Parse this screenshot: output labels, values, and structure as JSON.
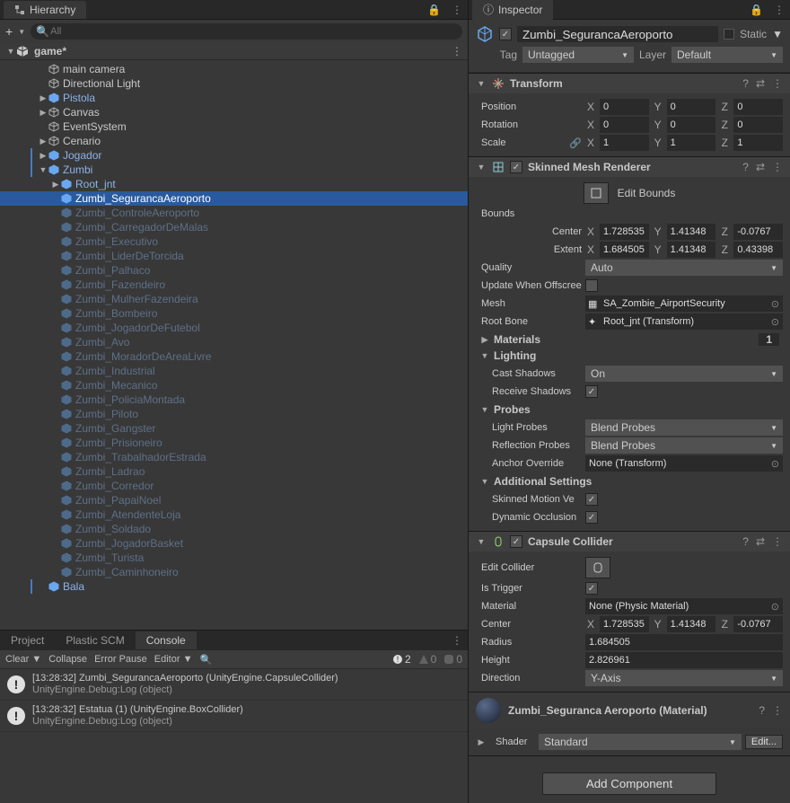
{
  "hierarchy": {
    "tab": "Hierarchy",
    "search_placeholder": "All",
    "scene": "game*",
    "items": [
      {
        "label": "main camera",
        "depth": 1,
        "prefab": false,
        "ghost": false,
        "arrow": ""
      },
      {
        "label": "Directional Light",
        "depth": 1,
        "prefab": false,
        "ghost": false,
        "arrow": ""
      },
      {
        "label": "Pistola",
        "depth": 1,
        "prefab": true,
        "ghost": false,
        "arrow": "▶"
      },
      {
        "label": "Canvas",
        "depth": 1,
        "prefab": false,
        "ghost": false,
        "arrow": "▶"
      },
      {
        "label": "EventSystem",
        "depth": 1,
        "prefab": false,
        "ghost": false,
        "arrow": ""
      },
      {
        "label": "Cenario",
        "depth": 1,
        "prefab": false,
        "ghost": false,
        "arrow": "▶"
      },
      {
        "label": "Jogador",
        "depth": 1,
        "prefab": true,
        "ghost": false,
        "arrow": "▶",
        "bar": true
      },
      {
        "label": "Zumbi",
        "depth": 1,
        "prefab": true,
        "ghost": false,
        "arrow": "▼",
        "bar": true
      },
      {
        "label": "Root_jnt",
        "depth": 2,
        "prefab": true,
        "ghost": false,
        "arrow": "▶"
      },
      {
        "label": "Zumbi_SegurancaAeroporto",
        "depth": 2,
        "prefab": true,
        "ghost": false,
        "arrow": "",
        "selected": true
      },
      {
        "label": "Zumbi_ControleAeroporto",
        "depth": 2,
        "prefab": true,
        "ghost": true,
        "arrow": ""
      },
      {
        "label": "Zumbi_CarregadorDeMalas",
        "depth": 2,
        "prefab": true,
        "ghost": true,
        "arrow": ""
      },
      {
        "label": "Zumbi_Executivo",
        "depth": 2,
        "prefab": true,
        "ghost": true,
        "arrow": ""
      },
      {
        "label": "Zumbi_LiderDeTorcida",
        "depth": 2,
        "prefab": true,
        "ghost": true,
        "arrow": ""
      },
      {
        "label": "Zumbi_Palhaco",
        "depth": 2,
        "prefab": true,
        "ghost": true,
        "arrow": ""
      },
      {
        "label": "Zumbi_Fazendeiro",
        "depth": 2,
        "prefab": true,
        "ghost": true,
        "arrow": ""
      },
      {
        "label": "Zumbi_MulherFazendeira",
        "depth": 2,
        "prefab": true,
        "ghost": true,
        "arrow": ""
      },
      {
        "label": "Zumbi_Bombeiro",
        "depth": 2,
        "prefab": true,
        "ghost": true,
        "arrow": ""
      },
      {
        "label": "Zumbi_JogadorDeFutebol",
        "depth": 2,
        "prefab": true,
        "ghost": true,
        "arrow": ""
      },
      {
        "label": "Zumbi_Avo",
        "depth": 2,
        "prefab": true,
        "ghost": true,
        "arrow": ""
      },
      {
        "label": "Zumbi_MoradorDeAreaLivre",
        "depth": 2,
        "prefab": true,
        "ghost": true,
        "arrow": ""
      },
      {
        "label": "Zumbi_Industrial",
        "depth": 2,
        "prefab": true,
        "ghost": true,
        "arrow": ""
      },
      {
        "label": "Zumbi_Mecanico",
        "depth": 2,
        "prefab": true,
        "ghost": true,
        "arrow": ""
      },
      {
        "label": "Zumbi_PoliciaMontada",
        "depth": 2,
        "prefab": true,
        "ghost": true,
        "arrow": ""
      },
      {
        "label": "Zumbi_Piloto",
        "depth": 2,
        "prefab": true,
        "ghost": true,
        "arrow": ""
      },
      {
        "label": "Zumbi_Gangster",
        "depth": 2,
        "prefab": true,
        "ghost": true,
        "arrow": ""
      },
      {
        "label": "Zumbi_Prisioneiro",
        "depth": 2,
        "prefab": true,
        "ghost": true,
        "arrow": ""
      },
      {
        "label": "Zumbi_TrabalhadorEstrada",
        "depth": 2,
        "prefab": true,
        "ghost": true,
        "arrow": ""
      },
      {
        "label": "Zumbi_Ladrao",
        "depth": 2,
        "prefab": true,
        "ghost": true,
        "arrow": ""
      },
      {
        "label": "Zumbi_Corredor",
        "depth": 2,
        "prefab": true,
        "ghost": true,
        "arrow": ""
      },
      {
        "label": "Zumbi_PapaiNoel",
        "depth": 2,
        "prefab": true,
        "ghost": true,
        "arrow": ""
      },
      {
        "label": "Zumbi_AtendenteLoja",
        "depth": 2,
        "prefab": true,
        "ghost": true,
        "arrow": ""
      },
      {
        "label": "Zumbi_Soldado",
        "depth": 2,
        "prefab": true,
        "ghost": true,
        "arrow": ""
      },
      {
        "label": "Zumbi_JogadorBasket",
        "depth": 2,
        "prefab": true,
        "ghost": true,
        "arrow": ""
      },
      {
        "label": "Zumbi_Turista",
        "depth": 2,
        "prefab": true,
        "ghost": true,
        "arrow": ""
      },
      {
        "label": "Zumbi_Caminhoneiro",
        "depth": 2,
        "prefab": true,
        "ghost": true,
        "arrow": ""
      },
      {
        "label": "Bala",
        "depth": 1,
        "prefab": true,
        "ghost": false,
        "arrow": "",
        "bar": true
      }
    ]
  },
  "bottom": {
    "tabs": [
      "Project",
      "Plastic SCM",
      "Console"
    ],
    "active_tab": 2,
    "toolbar": {
      "clear": "Clear",
      "collapse": "Collapse",
      "error_pause": "Error Pause",
      "editor": "Editor"
    },
    "counts": {
      "info": "2",
      "warn": "0",
      "error": "0"
    },
    "logs": [
      {
        "time": "[13:28:32]",
        "msg": "Zumbi_SegurancaAeroporto (UnityEngine.CapsuleCollider)",
        "sub": "UnityEngine.Debug:Log (object)"
      },
      {
        "time": "[13:28:32]",
        "msg": "Estatua (1) (UnityEngine.BoxCollider)",
        "sub": "UnityEngine.Debug:Log (object)"
      }
    ]
  },
  "inspector": {
    "tab": "Inspector",
    "name": "Zumbi_SegurancaAeroporto",
    "static": "Static",
    "tag_label": "Tag",
    "tag": "Untagged",
    "layer_label": "Layer",
    "layer": "Default",
    "transform": {
      "title": "Transform",
      "position": {
        "label": "Position",
        "x": "0",
        "y": "0",
        "z": "0"
      },
      "rotation": {
        "label": "Rotation",
        "x": "0",
        "y": "0",
        "z": "0"
      },
      "scale": {
        "label": "Scale",
        "x": "1",
        "y": "1",
        "z": "1"
      }
    },
    "smr": {
      "title": "Skinned Mesh Renderer",
      "edit_bounds": "Edit Bounds",
      "bounds": "Bounds",
      "center_label": "Center",
      "center": {
        "x": "1.728535",
        "y": "1.41348",
        "z": "-0.0767"
      },
      "extent_label": "Extent",
      "extent": {
        "x": "1.684505",
        "y": "1.41348",
        "z": "0.43398"
      },
      "quality_label": "Quality",
      "quality": "Auto",
      "update_label": "Update When Offscreen",
      "mesh_label": "Mesh",
      "mesh": "SA_Zombie_AirportSecurity",
      "root_bone_label": "Root Bone",
      "root_bone": "Root_jnt (Transform)",
      "materials": "Materials",
      "materials_count": "1",
      "lighting": "Lighting",
      "cast_shadows_label": "Cast Shadows",
      "cast_shadows": "On",
      "receive_shadows": "Receive Shadows",
      "probes": "Probes",
      "light_probes_label": "Light Probes",
      "light_probes": "Blend Probes",
      "reflection_probes_label": "Reflection Probes",
      "reflection_probes": "Blend Probes",
      "anchor_override_label": "Anchor Override",
      "anchor_override": "None (Transform)",
      "additional": "Additional Settings",
      "skinned_motion": "Skinned Motion Ve",
      "dynamic_occlusion": "Dynamic Occlusion"
    },
    "capsule": {
      "title": "Capsule Collider",
      "edit_collider": "Edit Collider",
      "is_trigger": "Is Trigger",
      "material_label": "Material",
      "material": "None (Physic Material)",
      "center_label": "Center",
      "center": {
        "x": "1.728535",
        "y": "1.41348",
        "z": "-0.0767"
      },
      "radius_label": "Radius",
      "radius": "1.684505",
      "height_label": "Height",
      "height": "2.826961",
      "direction_label": "Direction",
      "direction": "Y-Axis"
    },
    "material": {
      "name": "Zumbi_Seguranca Aeroporto (Material)",
      "shader_label": "Shader",
      "shader": "Standard",
      "edit": "Edit..."
    },
    "add_component": "Add Component"
  }
}
